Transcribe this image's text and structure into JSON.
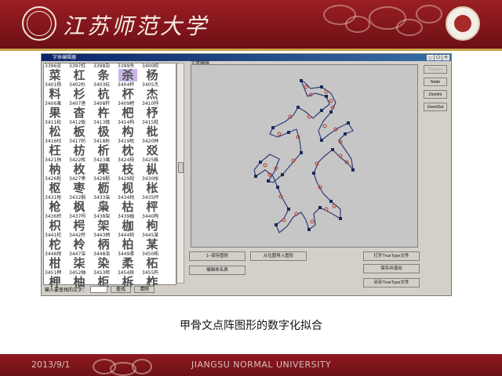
{
  "header": {
    "university_name": "江苏师范大学"
  },
  "window": {
    "title": "字体编辑器",
    "editor_label": "字体编辑",
    "char_grid": [
      {
        "code": "3396妥",
        "glyph": "菜"
      },
      {
        "code": "3397杠",
        "glyph": "杠"
      },
      {
        "code": "3398杂",
        "glyph": "条"
      },
      {
        "code": "3399杀",
        "glyph": "杀",
        "selected": true
      },
      {
        "code": "3400权",
        "glyph": "杨"
      },
      {
        "code": "3401杨",
        "glyph": "料"
      },
      {
        "code": "3402杉",
        "glyph": "杉"
      },
      {
        "code": "3403杭",
        "glyph": "杭"
      },
      {
        "code": "3404杯",
        "glyph": "杯"
      },
      {
        "code": "3405杰",
        "glyph": "杰"
      },
      {
        "code": "3406果",
        "glyph": "果"
      },
      {
        "code": "3407杳",
        "glyph": "杳"
      },
      {
        "code": "3408杵",
        "glyph": "杵"
      },
      {
        "code": "3409杷",
        "glyph": "杷"
      },
      {
        "code": "3410杼",
        "glyph": "杼"
      },
      {
        "code": "3411松",
        "glyph": "松"
      },
      {
        "code": "3412板",
        "glyph": "板"
      },
      {
        "code": "3413极",
        "glyph": "极"
      },
      {
        "code": "3414构",
        "glyph": "构"
      },
      {
        "code": "3415枇",
        "glyph": "枇"
      },
      {
        "code": "3416枉",
        "glyph": "枉"
      },
      {
        "code": "3417枋",
        "glyph": "枋"
      },
      {
        "code": "3418析",
        "glyph": "析"
      },
      {
        "code": "3419枕",
        "glyph": "枕"
      },
      {
        "code": "3420林",
        "glyph": "㸚"
      },
      {
        "code": "3421枘",
        "glyph": "枘"
      },
      {
        "code": "3422枚",
        "glyph": "枚"
      },
      {
        "code": "3423果",
        "glyph": "果"
      },
      {
        "code": "3424枝",
        "glyph": "枝"
      },
      {
        "code": "3425枞",
        "glyph": "枞"
      },
      {
        "code": "3426枢",
        "glyph": "枢"
      },
      {
        "code": "3427枣",
        "glyph": "枣"
      },
      {
        "code": "3428枥",
        "glyph": "枥"
      },
      {
        "code": "3429枧",
        "glyph": "枧"
      },
      {
        "code": "3430枨",
        "glyph": "枨"
      },
      {
        "code": "3431枪",
        "glyph": "枪"
      },
      {
        "code": "3432枫",
        "glyph": "枫"
      },
      {
        "code": "3433枭",
        "glyph": "枭"
      },
      {
        "code": "3434枯",
        "glyph": "枯"
      },
      {
        "code": "3435枰",
        "glyph": "枰"
      },
      {
        "code": "3436枳",
        "glyph": "枳"
      },
      {
        "code": "3437枵",
        "glyph": "枵"
      },
      {
        "code": "3438架",
        "glyph": "架"
      },
      {
        "code": "3439枷",
        "glyph": "枷"
      },
      {
        "code": "3440枸",
        "glyph": "枸"
      },
      {
        "code": "3441柁",
        "glyph": "柁"
      },
      {
        "code": "3442柃",
        "glyph": "柃"
      },
      {
        "code": "3443柄",
        "glyph": "柄"
      },
      {
        "code": "3444柏",
        "glyph": "柏"
      },
      {
        "code": "3445某",
        "glyph": "某"
      },
      {
        "code": "3446柑",
        "glyph": "柑"
      },
      {
        "code": "3447柒",
        "glyph": "柒"
      },
      {
        "code": "3448染",
        "glyph": "染"
      },
      {
        "code": "3449柔",
        "glyph": "柔"
      },
      {
        "code": "3450柘",
        "glyph": "柘"
      },
      {
        "code": "3451柙",
        "glyph": "柙"
      },
      {
        "code": "3452柚",
        "glyph": "柚"
      },
      {
        "code": "3453柜",
        "glyph": "柜"
      },
      {
        "code": "3454柝",
        "glyph": "柝"
      },
      {
        "code": "3455柞",
        "glyph": "柞"
      }
    ],
    "input_label": "输入要查找的文字：",
    "input_value": "",
    "find_button": "查找",
    "clear_button": "清除",
    "side_buttons": [
      {
        "label": "Polygon",
        "disabled": true
      },
      {
        "label": "Node",
        "disabled": false
      },
      {
        "label": "ZoomIn",
        "disabled": false
      },
      {
        "label": "ZoomOut",
        "disabled": false
      }
    ],
    "bottom_buttons": {
      "save_graphic": "1--保存图形",
      "import_graphic": "从位图导入图形",
      "open_truetype": "打开TrueType文件",
      "edit_nameplate": "编辑命名表",
      "save_changes": "保存并退出",
      "save_as_truetype": "另存TrueType文件"
    }
  },
  "caption": "甲骨文点阵图形的数字化拟合",
  "footer": {
    "date": "2013/9/1",
    "university": "JIANGSU NORMAL UNIVERSITY"
  },
  "colors": {
    "brand_red": "#8b1a1f",
    "gold": "#c9a24a",
    "selected_cell": "#c8b4e6",
    "canvas_bg": "#c6c6c6",
    "contour": "#2f3b7a",
    "node_red": "#c0392b"
  }
}
